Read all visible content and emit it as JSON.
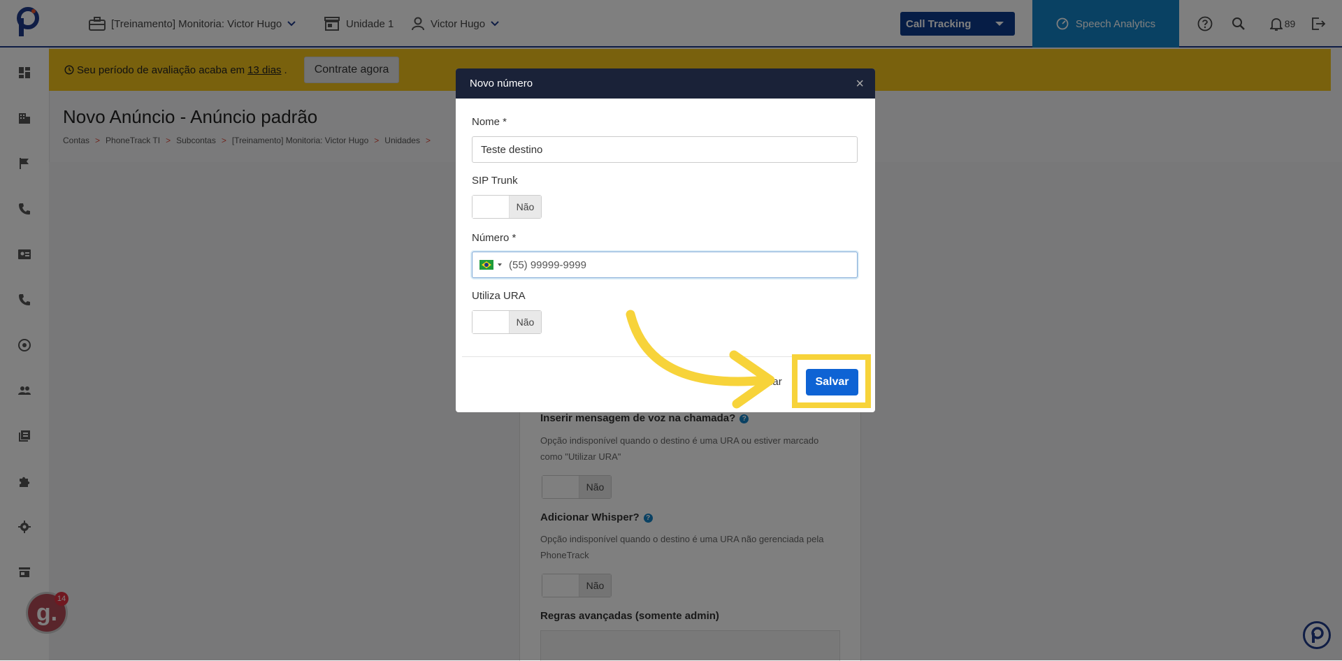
{
  "header": {
    "account": "[Treinamento] Monitoria: Victor Hugo",
    "unit": "Unidade 1",
    "user": "Victor Hugo",
    "product_select": "Call Tracking",
    "speech_analytics": "Speech Analytics",
    "notifications_count": "89"
  },
  "banner": {
    "text_before": "Seu período de avaliação acaba em",
    "days_link": "13 dias",
    "text_after": ".",
    "cta": "Contrate agora"
  },
  "page": {
    "title": "Novo Anúncio - Anúncio padrão",
    "breadcrumb": [
      "Contas",
      "PhoneTrack TI",
      "Subcontas",
      "[Treinamento] Monitoria: Victor Hugo",
      "Unidades"
    ],
    "breadcrumb_sep": ">"
  },
  "form_behind": {
    "voice_message_q": "Inserir mensagem de voz na chamada?",
    "voice_message_hint": "Opção indisponível quando o destino é uma URA ou estiver marcado como \"Utilizar URA\"",
    "voice_message_toggle": "Não",
    "whisper_q": "Adicionar Whisper?",
    "whisper_hint": "Opção indisponível quando o destino é uma URA não gerenciada pela PhoneTrack",
    "whisper_toggle": "Não",
    "advanced_rules": "Regras avançadas (somente admin)",
    "help_glyph": "?"
  },
  "modal": {
    "title": "Novo número",
    "close_glyph": "×",
    "name_label": "Nome *",
    "name_value": "Teste destino",
    "sip_label": "SIP Trunk",
    "sip_toggle": "Não",
    "number_label": "Número *",
    "number_placeholder": "(55) 99999-9999",
    "ura_label": "Utiliza URA",
    "ura_toggle": "Não",
    "close_button": "Fechar",
    "save_button": "Salvar"
  },
  "widgets": {
    "g_letter": "g.",
    "g_badge": "14"
  },
  "colors": {
    "brand_blue": "#0d3a8c",
    "speech_blue": "#1383c6",
    "banner_yellow": "#f3c21b",
    "highlight_yellow": "#f7d33a",
    "save_blue": "#0e63d4"
  }
}
